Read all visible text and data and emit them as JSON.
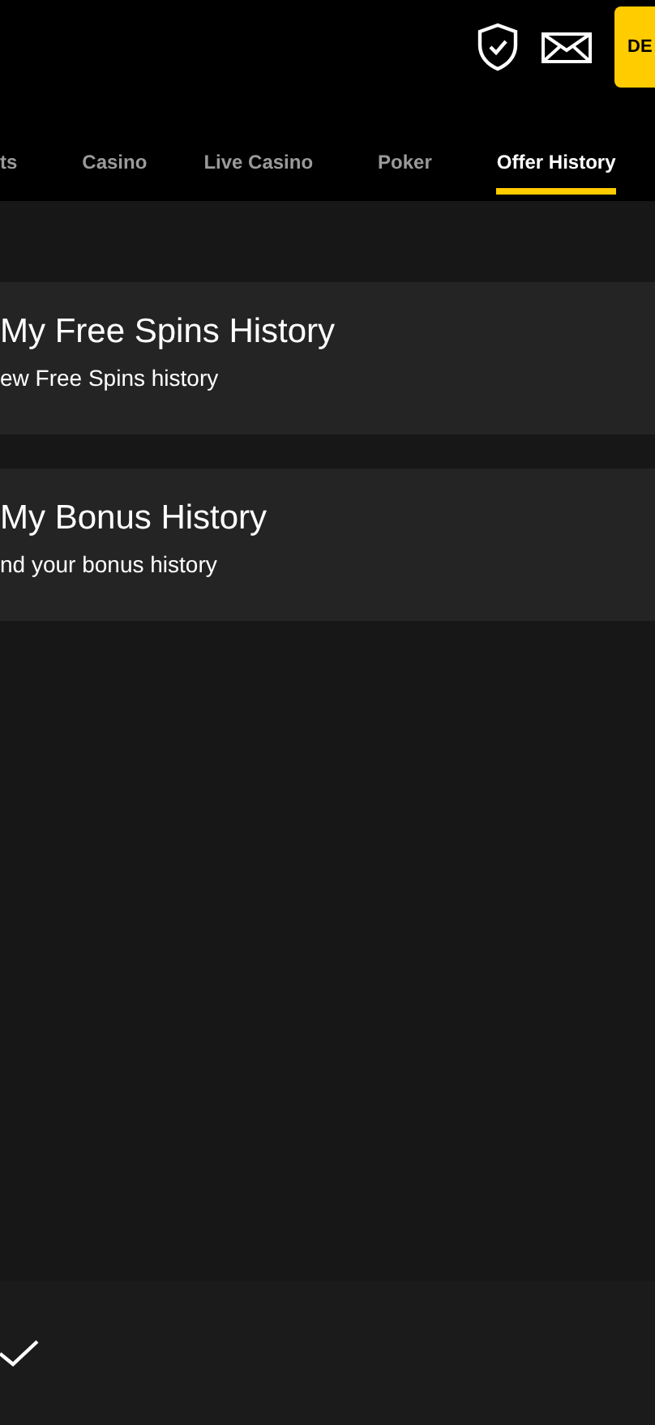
{
  "header": {
    "button": "DE"
  },
  "tabs": [
    {
      "label": "ts",
      "selected": false
    },
    {
      "label": "Casino",
      "selected": false
    },
    {
      "label": "Live Casino",
      "selected": false
    },
    {
      "label": "Poker",
      "selected": false
    },
    {
      "label": "Offer History",
      "selected": true
    }
  ],
  "cards": [
    {
      "title": "My Free Spins History",
      "subtitle": "ew Free Spins history"
    },
    {
      "title": "My Bonus History",
      "subtitle": "nd your bonus history"
    }
  ]
}
